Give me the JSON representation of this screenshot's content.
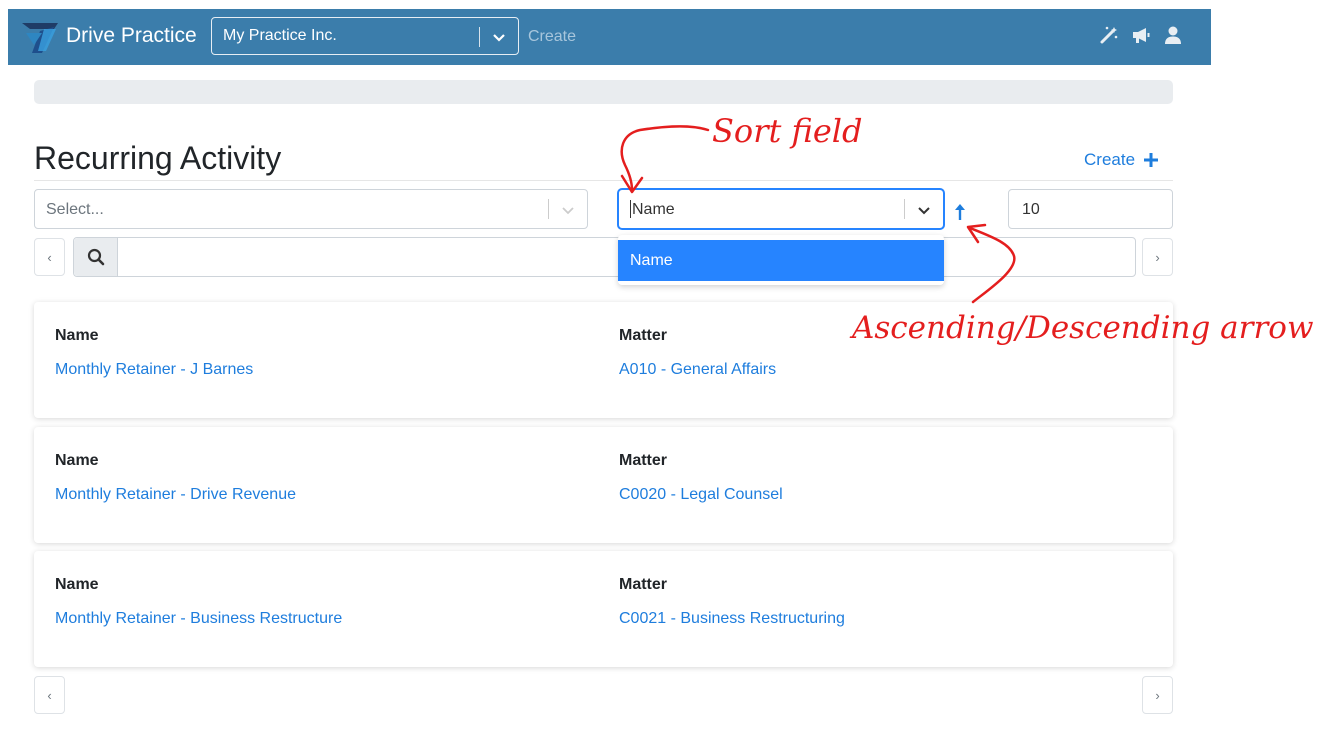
{
  "navbar": {
    "brand": "Drive Practice",
    "org_select_value": "My Practice Inc.",
    "create_label": "Create",
    "icons": [
      "magic-wand-icon",
      "megaphone-icon",
      "user-icon"
    ],
    "bg_color": "#3b7dab"
  },
  "page": {
    "title": "Recurring Activity",
    "create_label": "Create"
  },
  "filters": {
    "filter_placeholder": "Select...",
    "sort_field_value": "Name",
    "sort_direction": "ascending",
    "page_size": "10",
    "sort_options": [
      "Name"
    ]
  },
  "pagination": {
    "prev_label": "‹",
    "next_label": "›"
  },
  "records": [
    {
      "name_label": "Name",
      "name": "Monthly Retainer - J Barnes",
      "matter_label": "Matter",
      "matter": "A010 - General Affairs"
    },
    {
      "name_label": "Name",
      "name": "Monthly Retainer - Drive Revenue",
      "matter_label": "Matter",
      "matter": "C0020 - Legal Counsel"
    },
    {
      "name_label": "Name",
      "name": "Monthly Retainer - Business Restructure",
      "matter_label": "Matter",
      "matter": "C0021 - Business Restructuring"
    }
  ],
  "annotations": {
    "sort_field": "Sort field",
    "sort_arrow": "Ascending/Descending arrow",
    "color": "#e41e1e"
  },
  "colors": {
    "link": "#1e7ddd",
    "focus": "#2684ff"
  }
}
